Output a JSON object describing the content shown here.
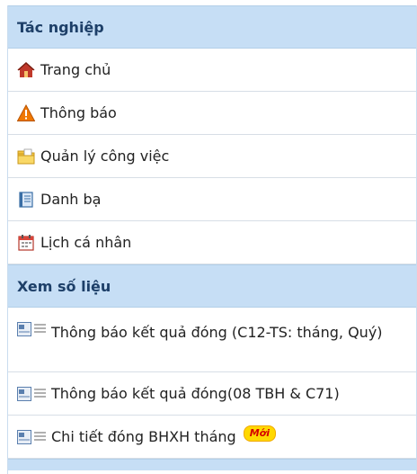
{
  "sections": [
    {
      "title": "Tác nghiệp",
      "items": [
        {
          "label": "Trang chủ",
          "icon": "home-icon"
        },
        {
          "label": "Thông báo",
          "icon": "warning-icon"
        },
        {
          "label": "Quản lý công việc",
          "icon": "folder-icon"
        },
        {
          "label": "Danh bạ",
          "icon": "contacts-book-icon"
        },
        {
          "label": "Lịch cá nhân",
          "icon": "calendar-icon"
        }
      ]
    },
    {
      "title": "Xem số liệu",
      "items": [
        {
          "label": "Thông báo kết quả đóng (C12-TS: tháng, Quý)",
          "icon": "report-card-icon"
        },
        {
          "label": "Thông báo kết quả đóng(08 TBH & C71)",
          "icon": "report-card-icon"
        },
        {
          "label": "Chi tiết đóng BHXH tháng",
          "icon": "report-card-icon",
          "badge": "Mới"
        }
      ]
    }
  ],
  "colors": {
    "header_bg": "#c6def5",
    "header_text": "#1d3f68",
    "warning": "#f07800",
    "badge_bg": "#ffd800",
    "badge_text": "#d40000"
  }
}
